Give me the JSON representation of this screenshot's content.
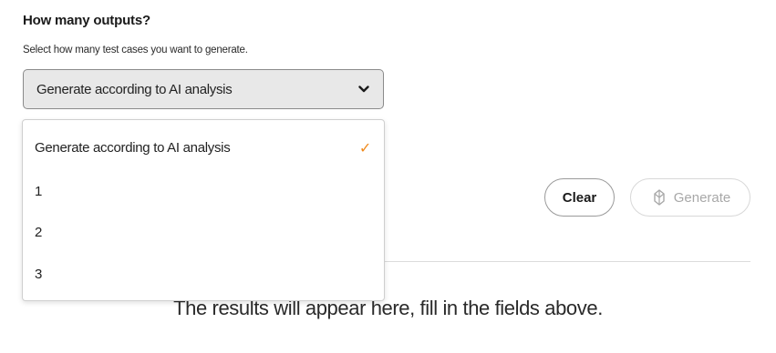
{
  "outputs_section": {
    "title": "How many outputs?",
    "subtitle": "Select how many test cases you want to generate.",
    "select": {
      "value": "Generate according to AI analysis",
      "chevron_icon": "chevron-down-icon"
    },
    "dropdown": {
      "options": [
        {
          "label": "Generate according to AI analysis",
          "selected": true
        },
        {
          "label": "1",
          "selected": false
        },
        {
          "label": "2",
          "selected": false
        },
        {
          "label": "3",
          "selected": false
        }
      ],
      "check_icon": "check-icon",
      "check_color": "#f08a1c"
    }
  },
  "actions": {
    "clear_label": "Clear",
    "generate_label": "Generate",
    "generate_icon": "sparkle-icon"
  },
  "results": {
    "placeholder": "The results will appear here, fill in the fields above."
  }
}
